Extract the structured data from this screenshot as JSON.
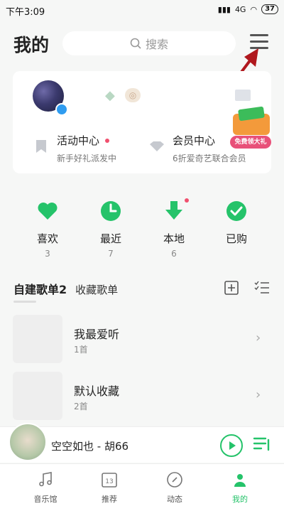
{
  "status_bar": {
    "time": "下午3:09",
    "network": "4G",
    "battery": "37"
  },
  "header": {
    "title": "我的",
    "search_placeholder": "搜索"
  },
  "profile": {
    "promo_left": {
      "title": "活动中心",
      "subtitle": "新手好礼派发中"
    },
    "promo_right": {
      "title": "会员中心",
      "subtitle": "6折爱奇艺联合会员"
    },
    "gift_label": "免费领大礼"
  },
  "quick_access": [
    {
      "label": "喜欢",
      "count": "3",
      "icon": "heart-icon"
    },
    {
      "label": "最近",
      "count": "7",
      "icon": "clock-icon"
    },
    {
      "label": "本地",
      "count": "6",
      "icon": "download-icon"
    },
    {
      "label": "已购",
      "count": "",
      "icon": "check-icon"
    }
  ],
  "playlist_tabs": {
    "created_label": "自建歌单",
    "created_count": "2",
    "favorited_label": "收藏歌单"
  },
  "playlists": [
    {
      "name": "我最爱听",
      "count": "1首"
    },
    {
      "name": "默认收藏",
      "count": "2首"
    }
  ],
  "mini_player": {
    "song": "空空如也 - 胡66"
  },
  "bottom_nav": [
    {
      "label": "音乐馆",
      "icon": "music-note-icon"
    },
    {
      "label": "推荐",
      "icon": "calendar-icon"
    },
    {
      "label": "动态",
      "icon": "compass-icon"
    },
    {
      "label": "我的",
      "icon": "user-icon"
    }
  ],
  "colors": {
    "accent": "#25c36a",
    "background": "#f6f7f6",
    "red_dot": "#f0506e"
  }
}
